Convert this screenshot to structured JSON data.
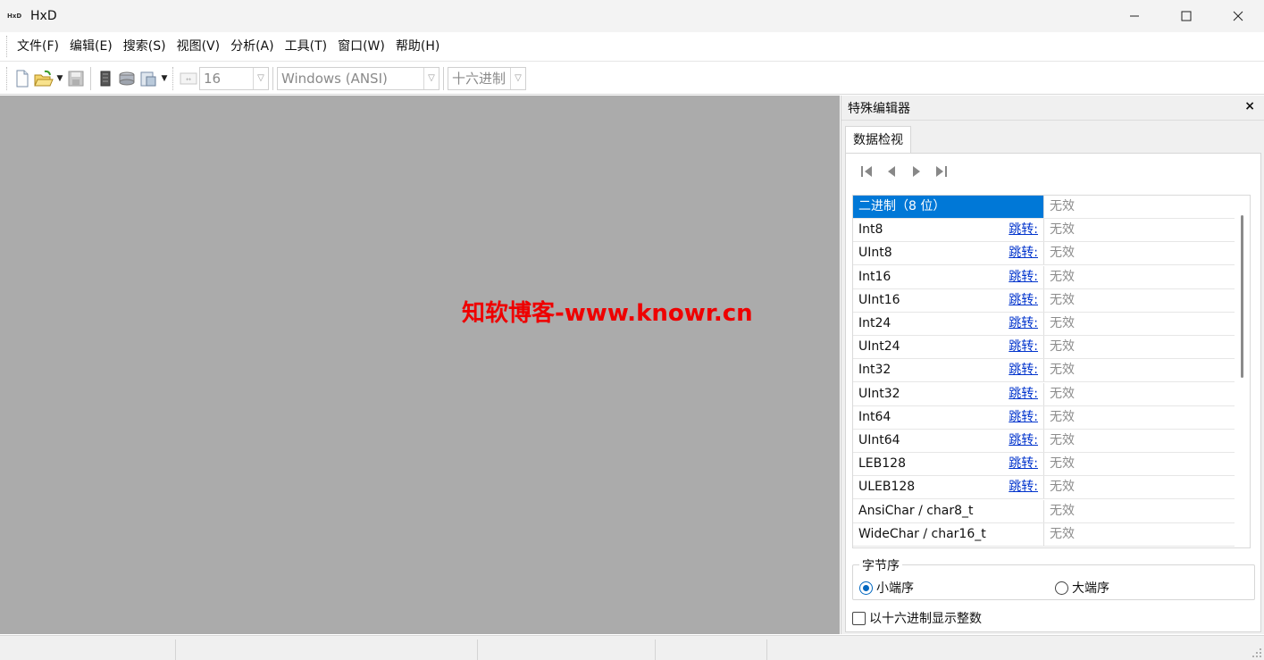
{
  "window": {
    "title": "HxD",
    "icon_label": "HxD",
    "controls": [
      "minimize-icon",
      "maximize-icon",
      "close-icon"
    ]
  },
  "menu": [
    "文件(F)",
    "编辑(E)",
    "搜索(S)",
    "视图(V)",
    "分析(A)",
    "工具(T)",
    "窗口(W)",
    "帮助(H)"
  ],
  "toolbar": {
    "icons": [
      "new-file-icon",
      "open-file-icon",
      "save-icon",
      "file-properties-icon",
      "disk-icon",
      "export-icon",
      "bytes-per-row-icon"
    ],
    "bytes_per_row": "16",
    "charset": "Windows (ANSI)",
    "offset_base": "十六进制"
  },
  "watermark": "知软博客-www.knowr.cn",
  "panel": {
    "title": "特殊编辑器",
    "close": "×",
    "tab": "数据检视",
    "nav_icons": [
      "first-icon",
      "previous-icon",
      "next-icon",
      "last-icon"
    ],
    "rows": [
      {
        "name": "二进制（8 位）",
        "jump": "",
        "value": "无效"
      },
      {
        "name": "Int8",
        "jump": "跳转:",
        "value": "无效"
      },
      {
        "name": "UInt8",
        "jump": "跳转:",
        "value": "无效"
      },
      {
        "name": "Int16",
        "jump": "跳转:",
        "value": "无效"
      },
      {
        "name": "UInt16",
        "jump": "跳转:",
        "value": "无效"
      },
      {
        "name": "Int24",
        "jump": "跳转:",
        "value": "无效"
      },
      {
        "name": "UInt24",
        "jump": "跳转:",
        "value": "无效"
      },
      {
        "name": "Int32",
        "jump": "跳转:",
        "value": "无效"
      },
      {
        "name": "UInt32",
        "jump": "跳转:",
        "value": "无效"
      },
      {
        "name": "Int64",
        "jump": "跳转:",
        "value": "无效"
      },
      {
        "name": "UInt64",
        "jump": "跳转:",
        "value": "无效"
      },
      {
        "name": "LEB128",
        "jump": "跳转:",
        "value": "无效"
      },
      {
        "name": "ULEB128",
        "jump": "跳转:",
        "value": "无效"
      },
      {
        "name": "AnsiChar / char8_t",
        "jump": "",
        "value": "无效"
      },
      {
        "name": "WideChar / char16_t",
        "jump": "",
        "value": "无效"
      }
    ],
    "byte_order": {
      "title": "字节序",
      "little": "小端序",
      "big": "大端序",
      "selected": "little"
    },
    "hex_checkbox": "以十六进制显示整数"
  },
  "colors": {
    "workspace": "#ababab",
    "selection": "#0078d7",
    "watermark": "#ee0000",
    "link": "#0033cc"
  }
}
